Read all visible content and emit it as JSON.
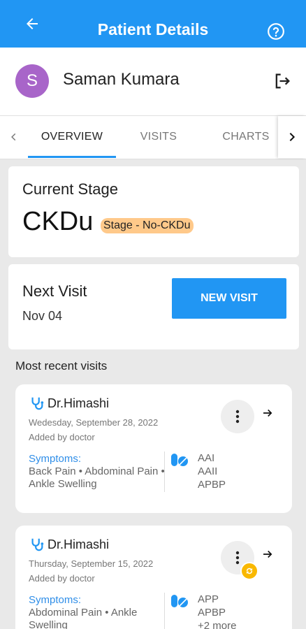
{
  "header": {
    "title": "Patient Details",
    "back_icon": "arrow-left-icon",
    "help_icon": "help-circle-icon"
  },
  "patient": {
    "initial": "S",
    "name": "Saman Kumara",
    "avatar_color": "#a865c9",
    "logout_icon": "logout-icon"
  },
  "tabs": [
    {
      "label": "OVERVIEW",
      "active": true
    },
    {
      "label": "VISITS",
      "active": false
    },
    {
      "label": "CHARTS",
      "active": false
    }
  ],
  "stage": {
    "label": "Current Stage",
    "value": "CKDu",
    "badge": "Stage - No-CKDu"
  },
  "next_visit": {
    "label": "Next Visit",
    "date": "Nov 04",
    "button": "NEW VISIT"
  },
  "recent": {
    "label": "Most recent visits",
    "visits": [
      {
        "doctor": "Dr.Himashi",
        "date": "Wedesday, September 28, 2022",
        "added_by": "Added by doctor",
        "symptoms_label": "Symptoms:",
        "symptoms": "Back Pain • Abdominal Pain • Ankle Swelling",
        "meds": [
          "AAI",
          "AAII",
          "APBP"
        ]
      },
      {
        "doctor": "Dr.Himashi",
        "date": "Thursday, September 15, 2022",
        "added_by": "Added by doctor",
        "symptoms_label": "Symptoms:",
        "symptoms": "Abdominal Pain • Ankle Swelling",
        "meds": [
          "APP",
          "APBP",
          "+2 more"
        ]
      }
    ]
  },
  "colors": {
    "primary": "#2196f3",
    "badge": "#ffc98a",
    "sync": "#f9b800"
  }
}
